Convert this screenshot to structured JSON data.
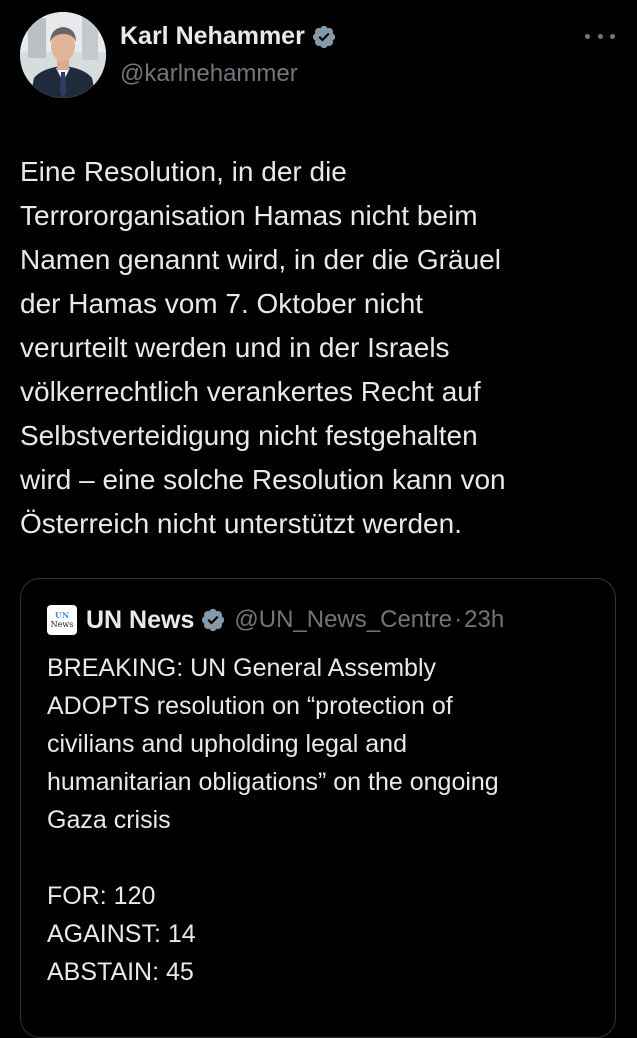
{
  "tweet": {
    "author": {
      "name": "Karl Nehammer",
      "handle": "@karlnehammer",
      "avatar_icon": "profile-photo",
      "verified_icon": "verified-badge-icon"
    },
    "more_icon": "more-horizontal-icon",
    "text": "Eine Resolution, in der die\nTerrororganisation Hamas nicht beim\nNamen genannt wird, in der die Gräuel\nder Hamas vom 7. Oktober nicht\nverurteilt werden und in der Israels\nvölkerrechtlich verankertes Recht auf\nSelbstverteidigung nicht festgehalten\nwird – eine solche Resolution kann von\nÖsterreich nicht unterstützt werden."
  },
  "quoted_tweet": {
    "logo_text_top": "UN",
    "logo_text_bottom": "News",
    "name": "UN News",
    "handle": "@UN_News_Centre",
    "separator": "·",
    "time": "23h",
    "text": "BREAKING: UN General Assembly\nADOPTS resolution on “protection of\ncivilians and upholding legal and\nhumanitarian obligations” on the ongoing\nGaza crisis\n\nFOR: 120\nAGAINST: 14\nABSTAIN: 45"
  },
  "colors": {
    "background": "#000000",
    "text_primary": "#e7e9ea",
    "text_secondary": "#71767b",
    "border": "#2f3336",
    "verified_badge": "#829aab"
  }
}
